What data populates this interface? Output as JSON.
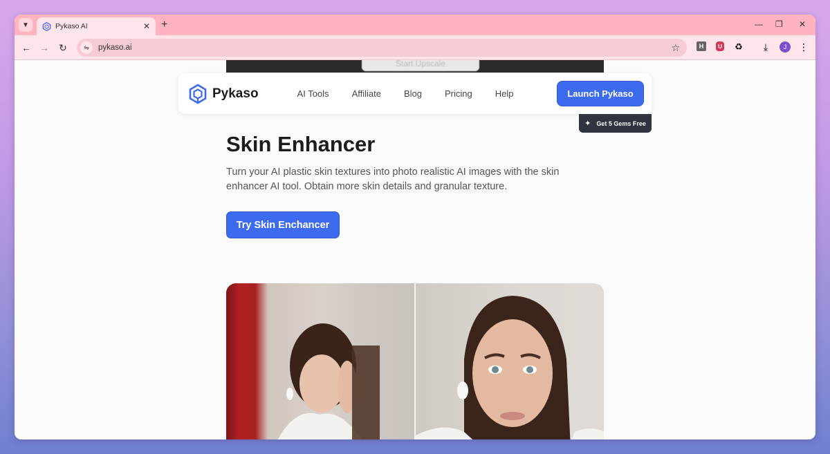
{
  "browser": {
    "tab_title": "Pykaso AI",
    "url": "pykaso.ai",
    "avatar_initial": "J",
    "ext_h_label": "H",
    "ext_u_label": "U"
  },
  "nav": {
    "brand": "Pykaso",
    "links": [
      "AI Tools",
      "Affiliate",
      "Blog",
      "Pricing",
      "Help"
    ],
    "launch_label": "Launch Pykaso",
    "gems_label": "Get 5 Gems Free"
  },
  "banner": {
    "partial_label": "Start Upscale"
  },
  "hero": {
    "title": "Skin Enhancer",
    "description": "Turn your AI plastic skin textures into photo realistic AI images  with the skin enhancer AI tool. Obtain more skin details and granular texture.",
    "cta_label": "Try Skin Enchancer"
  },
  "colors": {
    "accent": "#3d6bef",
    "tab_strip": "#ffb3c1",
    "toolbar": "#ffe4ea",
    "badge_bg": "#2f3440"
  },
  "icons": {
    "tab_menu": "chevron-down-icon",
    "back": "arrow-left-icon",
    "forward": "arrow-right-icon",
    "reload": "reload-icon",
    "bookmark": "star-icon",
    "download": "download-icon",
    "menu": "kebab-menu-icon"
  }
}
